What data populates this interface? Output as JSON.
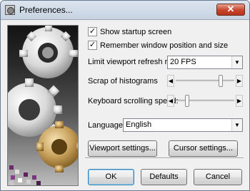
{
  "window": {
    "title": "Preferences..."
  },
  "titlebar": {
    "close_glyph": "✕",
    "app_icon": "gear-icon"
  },
  "options": {
    "show_startup_screen": {
      "label": "Show startup screen",
      "checked": true
    },
    "remember_window": {
      "label": "Remember window position and size",
      "checked": true
    }
  },
  "refresh_rate": {
    "label": "Limit viewport refresh rate:",
    "value": "20 FPS"
  },
  "histograms": {
    "label": "Scrap of histograms",
    "level": 0.85
  },
  "scrolling": {
    "label": "Keyboard scrolling speed:",
    "level": 0.15
  },
  "language": {
    "label": "Language:",
    "value": "English"
  },
  "buttons": {
    "viewport_settings": "Viewport settings...",
    "cursor_settings": "Cursor settings...",
    "ok": "OK",
    "defaults": "Defaults",
    "cancel": "Cancel"
  },
  "glyphs": {
    "check": "✓",
    "down": "▼",
    "left": "◀",
    "right": "▶"
  },
  "colors": {
    "gear_light": "#e8e8e8",
    "gear_gold": "#c7a05a",
    "pixel_purple": "#6a2c6a"
  }
}
